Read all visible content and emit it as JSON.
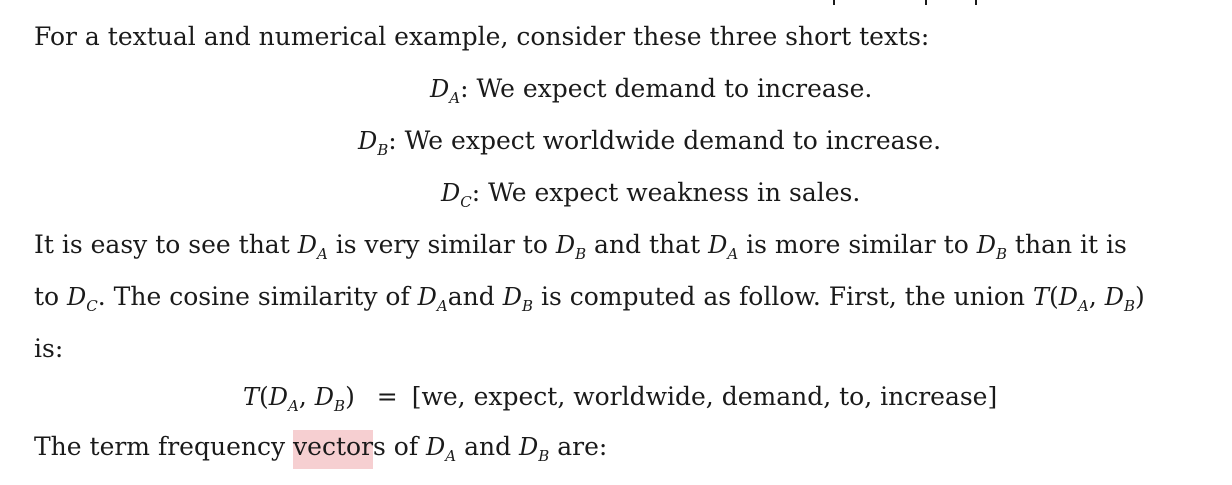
{
  "intro": "For a textual and numerical example, consider these three short texts:",
  "docs": [
    {
      "symbol": "D",
      "sub": "A",
      "text": ": We expect demand to increase."
    },
    {
      "symbol": "D",
      "sub": "B",
      "text": ": We expect worldwide demand to increase."
    },
    {
      "symbol": "D",
      "sub": "C",
      "text": ": We expect weakness in sales."
    }
  ],
  "para": {
    "l1_a": "It is easy to see that ",
    "l1_b": " is very similar to ",
    "l1_c": " and that ",
    "l1_d": " is more similar to ",
    "l1_e": " than it is",
    "l2_a": "to ",
    "l2_b": ". The cosine similarity of ",
    "l2_c": "and ",
    "l2_d": " is computed as follow. First, the union ",
    "l3": "is:"
  },
  "union": {
    "lhs": "T",
    "equals": "=",
    "rhs": "[we, expect, worldwide, demand, to, increase]"
  },
  "last": {
    "a": "The term frequency ",
    "hl": "vector",
    "b": "s of ",
    "c": " and ",
    "d": " are:"
  }
}
